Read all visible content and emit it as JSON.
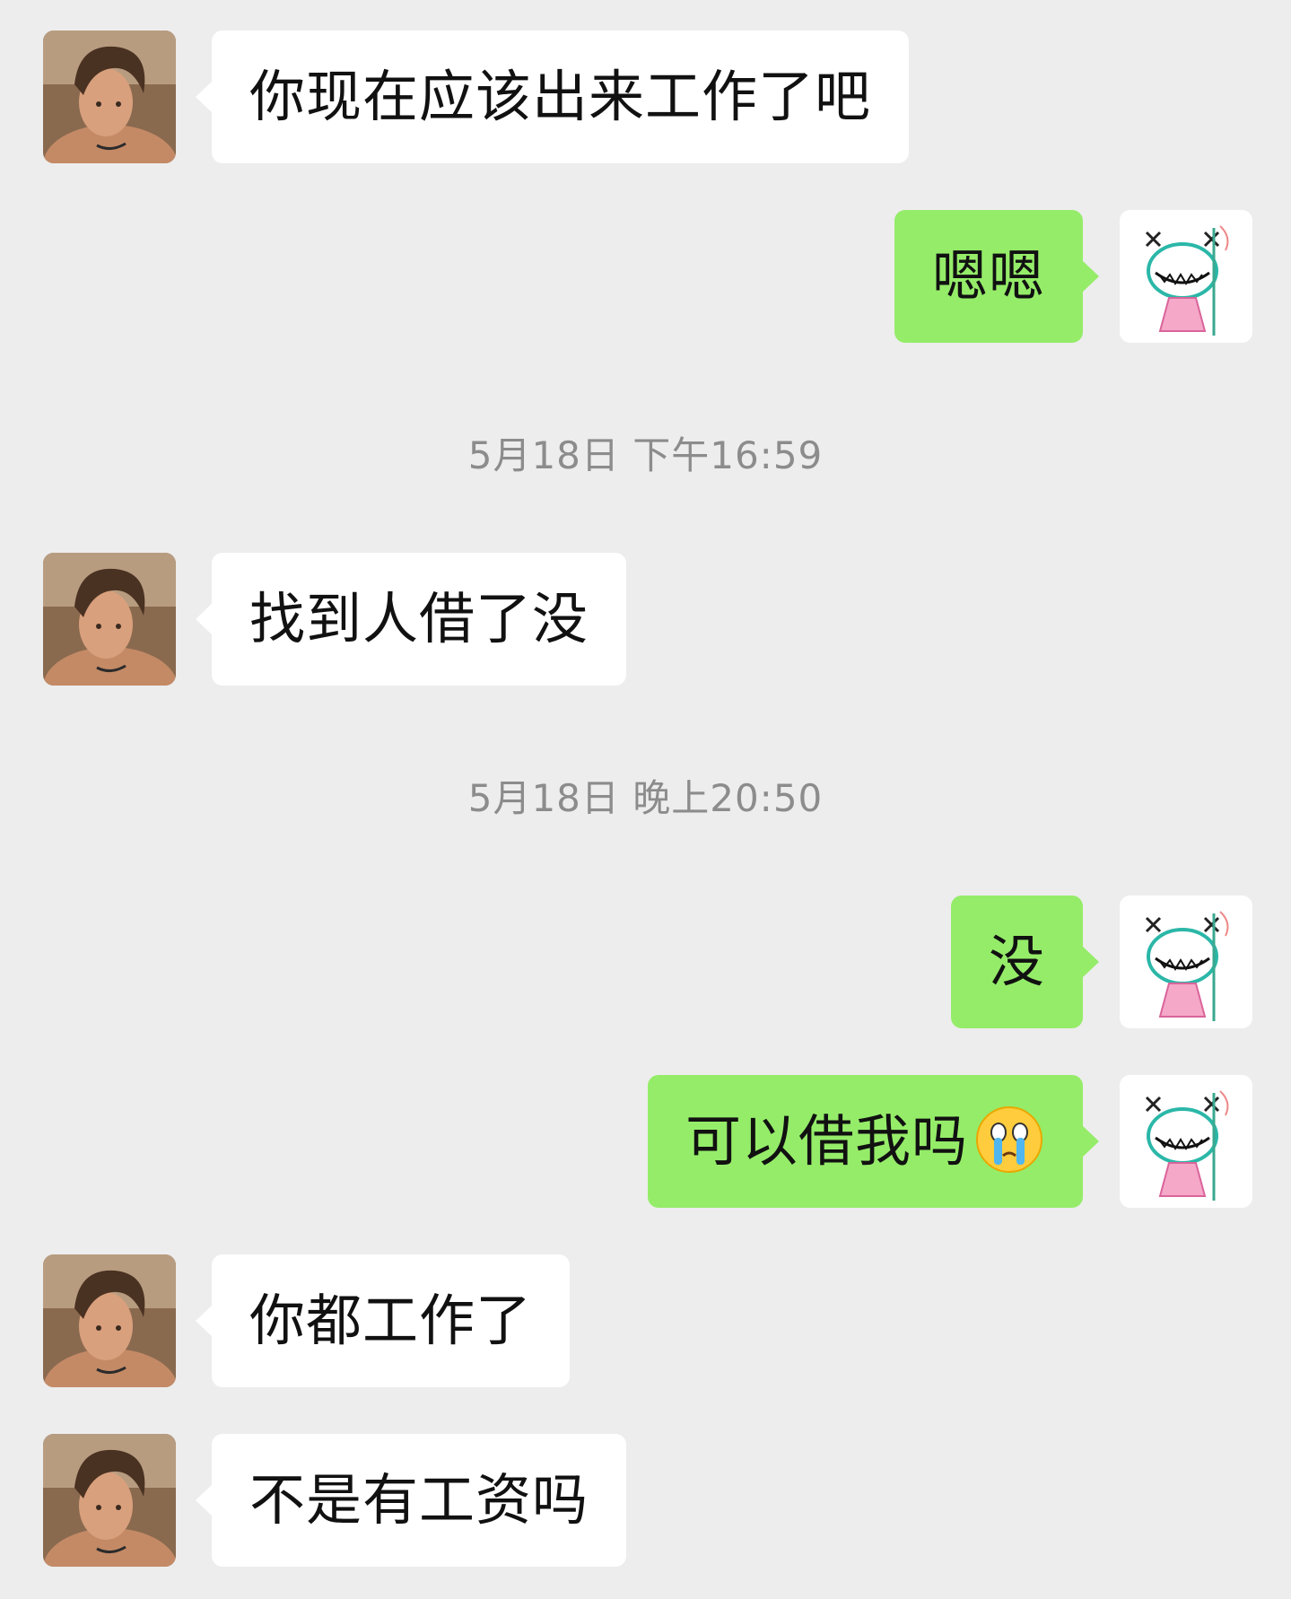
{
  "colors": {
    "background": "#ededed",
    "incoming_bubble": "#ffffff",
    "outgoing_bubble": "#95ec69",
    "timestamp_text": "#8c8c8c"
  },
  "messages": [
    {
      "side": "in",
      "text": "你现在应该出来工作了吧"
    },
    {
      "side": "out",
      "text": "嗯嗯"
    },
    {
      "side": "in",
      "text": "找到人借了没"
    },
    {
      "side": "out",
      "text": "没"
    },
    {
      "side": "out",
      "text": "可以借我吗",
      "emoji": "crying-face-emoji"
    },
    {
      "side": "in",
      "text": "你都工作了"
    },
    {
      "side": "in",
      "text": "不是有工资吗"
    }
  ],
  "timestamps": [
    "5月18日 下午16:59",
    "5月18日 晚上20:50"
  ],
  "avatars": {
    "contact": "contact-avatar-photo",
    "self": "self-avatar-cartoon-girl"
  }
}
